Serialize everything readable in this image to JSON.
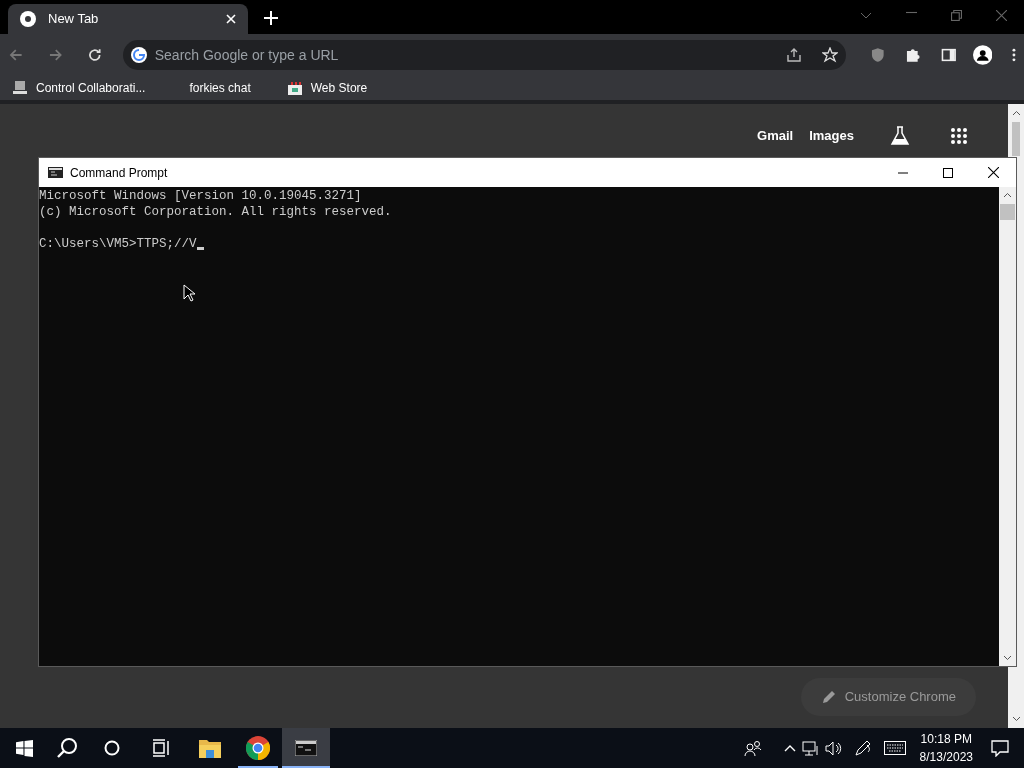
{
  "browser": {
    "tabs": [
      {
        "title": "New Tab",
        "selected": true
      }
    ],
    "omnibox": {
      "placeholder": "Search Google or type a URL"
    },
    "bookmarks": [
      {
        "label": "Control Collaborati...",
        "kind": "computer"
      },
      {
        "label": "forkies chat",
        "kind": "none"
      },
      {
        "label": "Web Store",
        "kind": "store"
      }
    ],
    "header_links": [
      "Gmail",
      "Images"
    ],
    "customize_button": "Customize Chrome"
  },
  "console_window": {
    "title": "Command Prompt",
    "output": [
      "Microsoft Windows [Version 10.0.19045.3271]",
      "(c) Microsoft Corporation. All rights reserved."
    ],
    "prompt": "C:\\Users\\VM5>TTPS;//V"
  },
  "taskbar": {
    "apps": [
      {
        "kind": "explorer",
        "running": false,
        "selected": false
      },
      {
        "kind": "chrome",
        "running": true,
        "selected": false
      },
      {
        "kind": "console",
        "running": true,
        "selected": true
      }
    ],
    "time": "10:18 PM",
    "date": "8/13/2023"
  }
}
